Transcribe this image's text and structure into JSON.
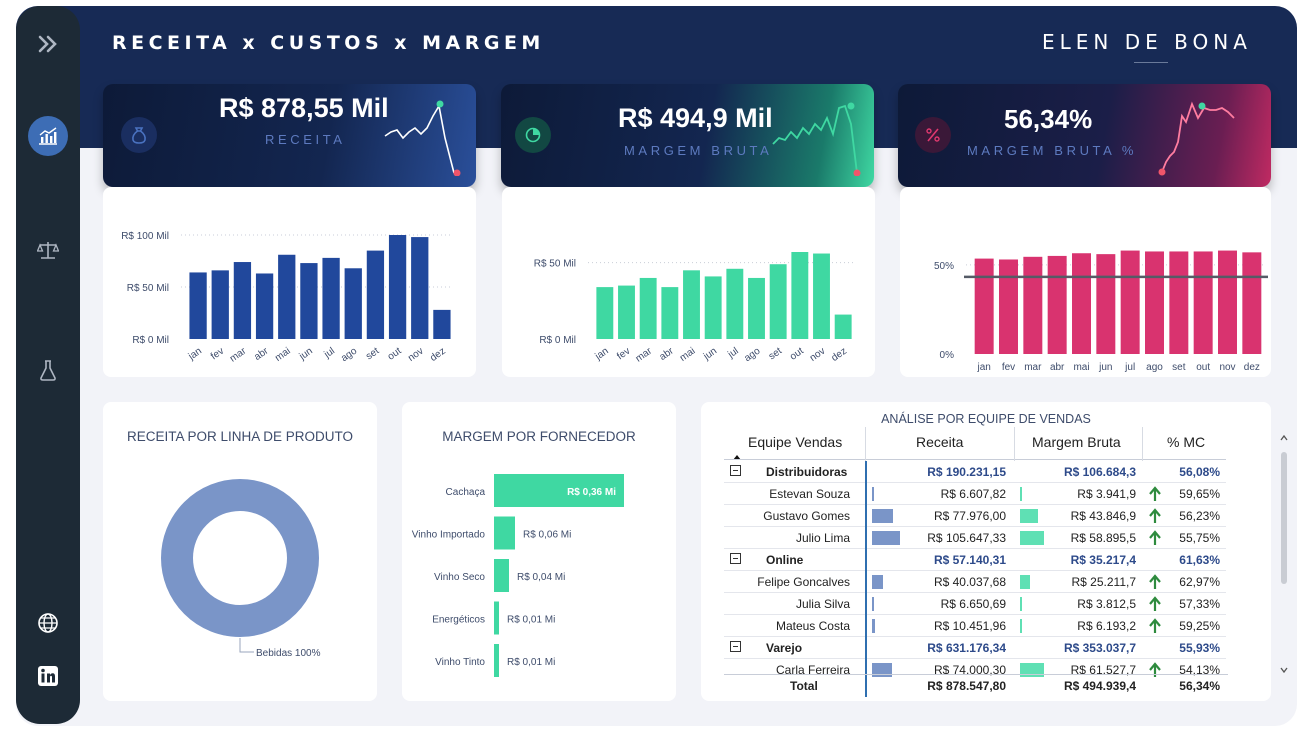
{
  "header": {
    "title": "RECEITA x CUSTOS x MARGEM",
    "brand": "ELEN DE BONA"
  },
  "sidebar": {
    "items": [
      {
        "icon": "double-chevron-right-icon"
      },
      {
        "icon": "chart-icon",
        "active": true
      },
      {
        "icon": "scale-icon"
      },
      {
        "icon": "flask-icon"
      },
      {
        "icon": "globe-icon"
      },
      {
        "icon": "linkedin-icon"
      }
    ]
  },
  "kpis": {
    "receita": {
      "value": "R$ 878,55 Mil",
      "label": "RECEITA",
      "icon": "money-bag-icon",
      "color": "#2a4f9a"
    },
    "margem": {
      "value": "R$ 494,9 Mil",
      "label": "MARGEM BRUTA",
      "icon": "pie-chart-icon",
      "color": "#3fd8a2"
    },
    "percent": {
      "value": "56,34%",
      "label": "MARGEM BRUTA %",
      "icon": "percent-icon",
      "color": "#d9336f"
    }
  },
  "chart_data": [
    {
      "type": "bar",
      "categories": [
        "jan",
        "fev",
        "mar",
        "abr",
        "mai",
        "jun",
        "jul",
        "ago",
        "set",
        "out",
        "nov",
        "dez"
      ],
      "values": [
        64,
        66,
        74,
        63,
        81,
        73,
        78,
        68,
        85,
        100,
        98,
        28
      ],
      "ytick_labels": [
        "R$ 0 Mil",
        "R$ 50 Mil",
        "R$ 100 Mil"
      ],
      "yticks": [
        0,
        50,
        100
      ],
      "ylim": [
        0,
        100
      ],
      "color": "#21489c"
    },
    {
      "type": "bar",
      "categories": [
        "jan",
        "fev",
        "mar",
        "abr",
        "mai",
        "jun",
        "jul",
        "ago",
        "set",
        "out",
        "nov",
        "dez"
      ],
      "values": [
        34,
        35,
        40,
        34,
        45,
        41,
        46,
        40,
        49,
        57,
        56,
        16
      ],
      "ytick_labels": [
        "R$ 0 Mil",
        "R$ 50 Mil"
      ],
      "yticks": [
        0,
        50
      ],
      "ylim": [
        0,
        50
      ],
      "color": "#3fd8a2"
    },
    {
      "type": "bar",
      "categories": [
        "jan",
        "fev",
        "mar",
        "abr",
        "mai",
        "jun",
        "jul",
        "ago",
        "set",
        "out",
        "nov",
        "dez"
      ],
      "values": [
        53.5,
        53,
        54.5,
        55,
        56.5,
        56,
        58,
        57.5,
        57.5,
        57.5,
        58,
        57
      ],
      "ytick_labels": [
        "0%",
        "50%"
      ],
      "yticks": [
        0,
        50
      ],
      "ylim": [
        0,
        50
      ],
      "reference_line": 41,
      "color": "#d9336f"
    },
    {
      "type": "pie",
      "title": "RECEITA POR LINHA DE PRODUTO",
      "categories": [
        "Bebidas"
      ],
      "values": [
        100
      ],
      "labels": [
        "Bebidas 100%"
      ],
      "color": "#7a95c8"
    },
    {
      "type": "bar",
      "title": "MARGEM POR FORNECEDOR",
      "categories": [
        "Cachaça",
        "Vinho Importado",
        "Vinho Seco",
        "Energéticos",
        "Vinho Tinto"
      ],
      "values": [
        0.36,
        0.06,
        0.04,
        0.01,
        0.01
      ],
      "labels": [
        "R$ 0,36 Mi",
        "R$ 0,06 Mi",
        "R$ 0,04 Mi",
        "R$ 0,01 Mi",
        "R$ 0,01 Mi"
      ],
      "color": "#3fd8a2"
    }
  ],
  "table": {
    "title": "ANÁLISE POR EQUIPE DE VENDAS",
    "headers": [
      "Equipe Vendas",
      "Receita",
      "Margem Bruta",
      "% MC"
    ],
    "groups": [
      {
        "name": "Distribuidoras",
        "receita": "R$ 190.231,15",
        "margem": "R$ 106.684,3",
        "mc": "56,08%",
        "rows": [
          {
            "name": "Estevan Souza",
            "receita": "R$ 6.607,82",
            "receita_pct": 0.06,
            "margem": "R$ 3.941,9",
            "margem_pct": 0.06,
            "mc": "59,65%"
          },
          {
            "name": "Gustavo Gomes",
            "receita": "R$ 77.976,00",
            "receita_pct": 0.74,
            "margem": "R$ 43.846,9",
            "margem_pct": 0.75,
            "mc": "56,23%"
          },
          {
            "name": "Julio Lima",
            "receita": "R$ 105.647,33",
            "receita_pct": 1.0,
            "margem": "R$ 58.895,5",
            "margem_pct": 1.0,
            "mc": "55,75%"
          }
        ]
      },
      {
        "name": "Online",
        "receita": "R$ 57.140,31",
        "margem": "R$ 35.217,4",
        "mc": "61,63%",
        "rows": [
          {
            "name": "Felipe Goncalves",
            "receita": "R$ 40.037,68",
            "receita_pct": 0.38,
            "margem": "R$ 25.211,7",
            "margem_pct": 0.43,
            "mc": "62,97%"
          },
          {
            "name": "Julia Silva",
            "receita": "R$ 6.650,69",
            "receita_pct": 0.06,
            "margem": "R$ 3.812,5",
            "margem_pct": 0.06,
            "mc": "57,33%"
          },
          {
            "name": "Mateus Costa",
            "receita": "R$ 10.451,96",
            "receita_pct": 0.1,
            "margem": "R$ 6.193,2",
            "margem_pct": 0.1,
            "mc": "59,25%"
          }
        ]
      },
      {
        "name": "Varejo",
        "receita": "R$ 631.176,34",
        "margem": "R$ 353.037,7",
        "mc": "55,93%",
        "rows": [
          {
            "name": "Carla Ferreira",
            "receita": "R$ 74.000,30",
            "receita_pct": 0.7,
            "margem": "R$ 61.527,7",
            "margem_pct": 1.0,
            "mc": "54,13%"
          }
        ]
      }
    ],
    "total": {
      "name": "Total",
      "receita": "R$ 878.547,80",
      "margem": "R$ 494.939,4",
      "mc": "56,34%"
    },
    "accent_color": "#2d4a8a",
    "up_color": "#2e8b3e"
  }
}
